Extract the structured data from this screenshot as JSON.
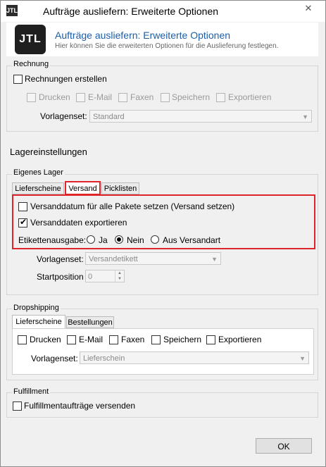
{
  "window": {
    "title": "Aufträge ausliefern: Erweiterte Optionen",
    "close_glyph": "✕",
    "app_icon": "JTL"
  },
  "header": {
    "logo": "JTL",
    "title": "Aufträge ausliefern: Erweiterte Optionen",
    "subtitle": "Hier können Sie die erweiterten Optionen für die Auslieferung festlegen."
  },
  "rechnung": {
    "legend": "Rechnung",
    "create_label": "Rechnungen erstellen",
    "create_checked": false,
    "options": [
      {
        "label": "Drucken"
      },
      {
        "label": "E-Mail"
      },
      {
        "label": "Faxen"
      },
      {
        "label": "Speichern"
      },
      {
        "label": "Exportieren"
      }
    ],
    "vorlagenset_label": "Vorlagenset:",
    "vorlagenset_value": "Standard"
  },
  "lager": {
    "heading": "Lagereinstellungen",
    "group_legend": "Eigenes Lager",
    "tabs": [
      "Lieferscheine",
      "Versand",
      "Picklisten"
    ],
    "active_tab": "Versand",
    "versanddatum_label": "Versanddatum für alle Pakete setzen (Versand setzen)",
    "versanddatum_checked": false,
    "export_label": "Versanddaten exportieren",
    "export_checked": true,
    "etiketten_label": "Etikettenausgabe:",
    "radio_options": [
      "Ja",
      "Nein",
      "Aus Versandart"
    ],
    "radio_selected": "Nein",
    "vorlagenset_label": "Vorlagenset:",
    "vorlagenset_value": "Versandetikett",
    "startposition_label": "Startposition",
    "startposition_value": "0"
  },
  "dropshipping": {
    "legend": "Dropshipping",
    "tabs": [
      "Lieferscheine",
      "Bestellungen"
    ],
    "active_tab": "Lieferscheine",
    "options": [
      {
        "label": "Drucken"
      },
      {
        "label": "E-Mail"
      },
      {
        "label": "Faxen"
      },
      {
        "label": "Speichern"
      },
      {
        "label": "Exportieren"
      }
    ],
    "vorlagenset_label": "Vorlagenset:",
    "vorlagenset_value": "Lieferschein"
  },
  "fulfillment": {
    "legend": "Fulfillment",
    "label": "Fulfillmentaufträge versenden",
    "checked": false
  },
  "footer": {
    "ok_label": "OK"
  },
  "colors": {
    "accent": "#1b5ea8",
    "highlight_border": "#e0252a"
  }
}
